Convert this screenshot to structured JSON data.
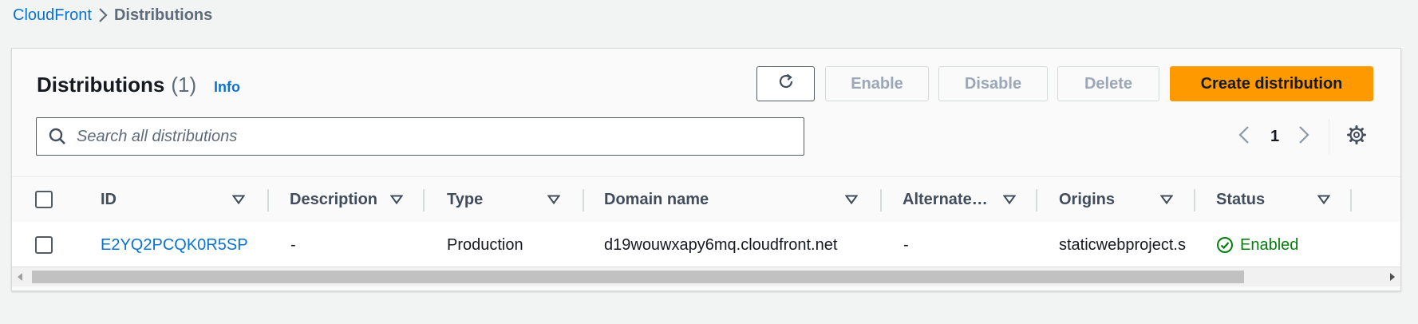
{
  "breadcrumb": {
    "root": "CloudFront",
    "current": "Distributions"
  },
  "panel": {
    "title": "Distributions",
    "count": "(1)",
    "info": "Info"
  },
  "toolbar": {
    "refresh_icon": "refresh-icon",
    "enable": "Enable",
    "disable": "Disable",
    "delete": "Delete",
    "create": "Create distribution",
    "create_color": "#ff9900"
  },
  "search": {
    "placeholder": "Search all distributions",
    "value": ""
  },
  "pagination": {
    "page": "1"
  },
  "table": {
    "columns": [
      "ID",
      "Description",
      "Type",
      "Domain name",
      "Alternate…",
      "Origins",
      "Status"
    ],
    "rows": [
      {
        "id": "E2YQ2PCQK0R5SP",
        "description": "-",
        "type": "Production",
        "domain": "d19wouwxapy6mq.cloudfront.net",
        "alternate": "-",
        "origins": "staticwebproject.s",
        "status": "Enabled"
      }
    ]
  },
  "colors": {
    "link": "#0972d3",
    "success": "#037f0c"
  }
}
